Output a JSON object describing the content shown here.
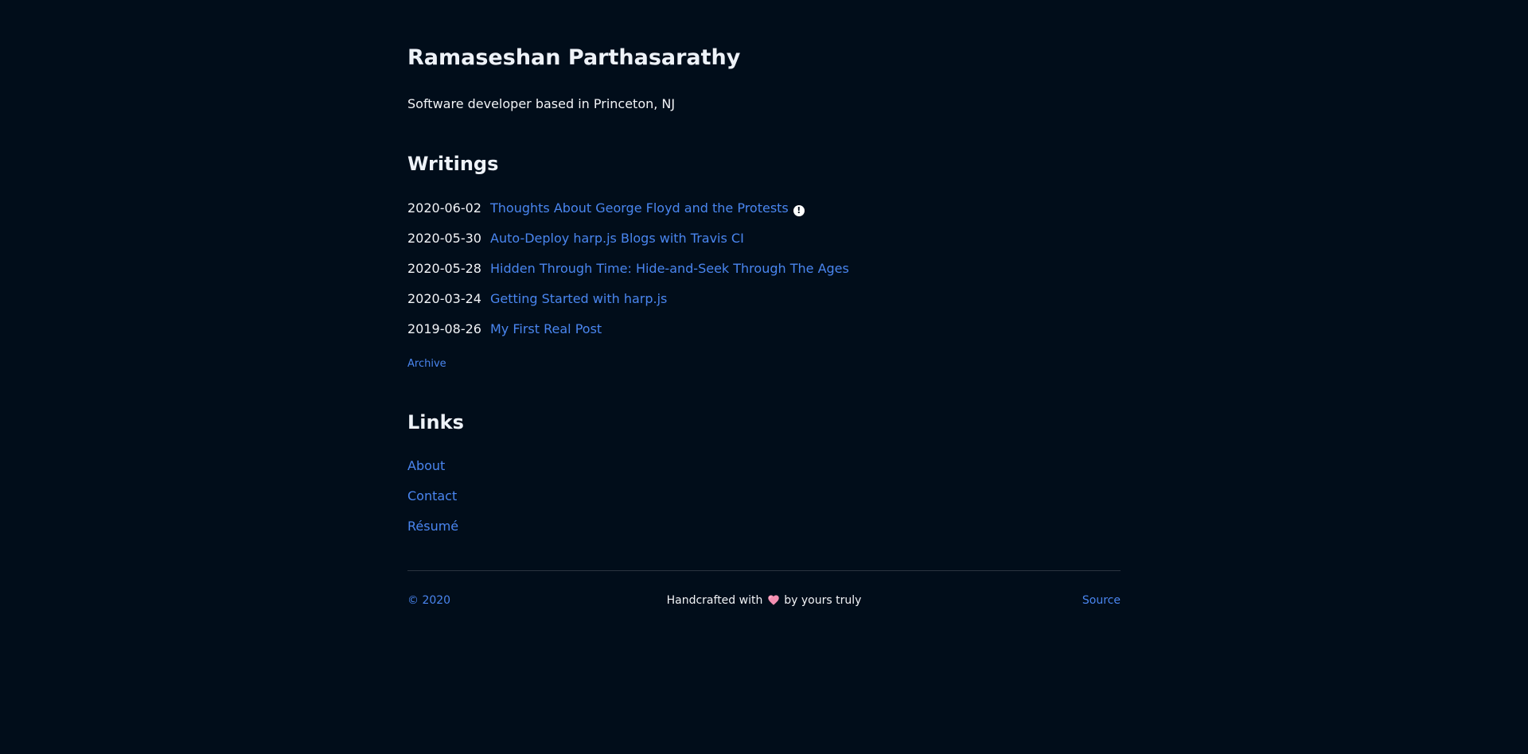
{
  "header": {
    "name": "Ramaseshan Parthasarathy",
    "tagline": "Software developer based in Princeton, NJ"
  },
  "writings": {
    "heading": "Writings",
    "posts": [
      {
        "date": "2020-06-02",
        "title": "Thoughts About George Floyd and the Protests",
        "icon": "alert-icon"
      },
      {
        "date": "2020-05-30",
        "title": "Auto-Deploy harp.js Blogs with Travis CI"
      },
      {
        "date": "2020-05-28",
        "title": "Hidden Through Time: Hide-and-Seek Through The Ages"
      },
      {
        "date": "2020-03-24",
        "title": "Getting Started with harp.js"
      },
      {
        "date": "2019-08-26",
        "title": "My First Real Post"
      }
    ],
    "archive_label": "Archive"
  },
  "links": {
    "heading": "Links",
    "items": [
      {
        "label": "About"
      },
      {
        "label": "Contact"
      },
      {
        "label": "Résumé"
      }
    ]
  },
  "footer": {
    "copyright": "© 2020",
    "credit_before": "Handcrafted with",
    "credit_icon": "heart-icon",
    "credit_after": "by yours truly",
    "source_label": "Source"
  },
  "colors": {
    "background": "#010d1a",
    "text": "#f2f4f7",
    "link": "#4a86f0",
    "divider": "#2b3440",
    "heart": "#f48fb1"
  }
}
